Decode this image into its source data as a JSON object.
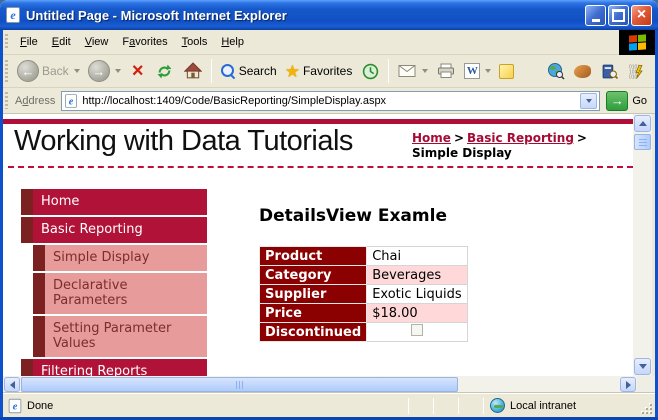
{
  "window": {
    "title": "Untitled Page - Microsoft Internet Explorer"
  },
  "menu": {
    "items": [
      {
        "pre": "",
        "accel": "F",
        "post": "ile"
      },
      {
        "pre": "",
        "accel": "E",
        "post": "dit"
      },
      {
        "pre": "",
        "accel": "V",
        "post": "iew"
      },
      {
        "pre": "F",
        "accel": "a",
        "post": "vorites"
      },
      {
        "pre": "",
        "accel": "T",
        "post": "ools"
      },
      {
        "pre": "",
        "accel": "H",
        "post": "elp"
      }
    ]
  },
  "toolbar": {
    "back": "Back",
    "search": "Search",
    "favorites": "Favorites"
  },
  "address": {
    "pre": "A",
    "accel": "d",
    "post": "dress",
    "url": "http://localhost:1409/Code/BasicReporting/SimpleDisplay.aspx",
    "go": "Go"
  },
  "page": {
    "title": "Working with Data Tutorials",
    "breadcrumb": {
      "sep": ">",
      "home": "Home",
      "section": "Basic Reporting",
      "current": "Simple Display"
    },
    "sidebar": [
      {
        "label": "Home",
        "level": 1
      },
      {
        "label": "Basic Reporting",
        "level": 1
      },
      {
        "label": "Simple Display",
        "level": 2
      },
      {
        "label": "Declarative Parameters",
        "level": 2
      },
      {
        "label": "Setting Parameter Values",
        "level": 2
      },
      {
        "label": "Filtering Reports",
        "level": 1
      }
    ],
    "heading": "DetailsView Examle",
    "details": {
      "rows": [
        {
          "field": "Product",
          "value": "Chai"
        },
        {
          "field": "Category",
          "value": "Beverages"
        },
        {
          "field": "Supplier",
          "value": "Exotic Liquids"
        },
        {
          "field": "Price",
          "value": "$18.00"
        },
        {
          "field": "Discontinued",
          "value": ""
        }
      ]
    }
  },
  "status": {
    "text": "Done",
    "zone": "Local intranet"
  },
  "colors": {
    "crimson": "#B00E38",
    "sidebar_strip": "#7B2121",
    "sidebar_pink": "#E89B9B",
    "sidebar_pink_text": "#7C2D2D",
    "table_header": "#8B0000",
    "table_alt_row": "#FFD9D9",
    "link": "#A50B35"
  }
}
